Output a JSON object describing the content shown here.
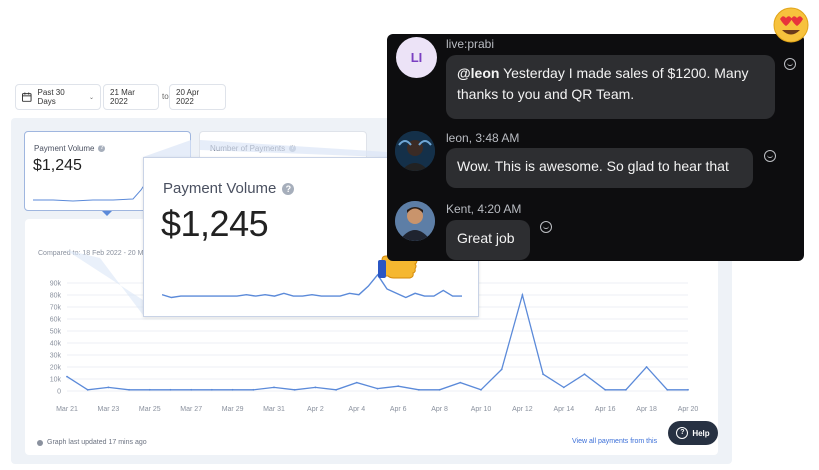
{
  "filters": {
    "range_label": "Past 30 Days",
    "start_date": "21 Mar 2022",
    "to_label": "to",
    "end_date": "20 Apr 2022"
  },
  "cards": {
    "payment_volume": {
      "title": "Payment Volume",
      "value": "$1,245"
    },
    "number_of_payments": {
      "title": "Number of Payments"
    }
  },
  "chart": {
    "compared_to": "Compared to: 18 Feb 2022 - 20 M",
    "footer_note": "Graph last updated 17 mins ago",
    "view_all": "View all payments from this"
  },
  "chart_data": {
    "type": "line",
    "x": [
      "Mar 21",
      "Mar 22",
      "Mar 23",
      "Mar 24",
      "Mar 25",
      "Mar 26",
      "Mar 27",
      "Mar 28",
      "Mar 29",
      "Mar 30",
      "Mar 31",
      "Apr 1",
      "Apr 2",
      "Apr 3",
      "Apr 4",
      "Apr 5",
      "Apr 6",
      "Apr 7",
      "Apr 8",
      "Apr 9",
      "Apr 10",
      "Apr 11",
      "Apr 12",
      "Apr 13",
      "Apr 14",
      "Apr 15",
      "Apr 16",
      "Apr 17",
      "Apr 18",
      "Apr 19",
      "Apr 20"
    ],
    "x_tick_labels": [
      "Mar 21",
      "Mar 23",
      "Mar 25",
      "Mar 27",
      "Mar 29",
      "Mar 31",
      "Apr 2",
      "Apr 4",
      "Apr 6",
      "Apr 8",
      "Apr 10",
      "Apr 12",
      "Apr 14",
      "Apr 16",
      "Apr 18",
      "Apr 20"
    ],
    "values": [
      12000,
      1000,
      3000,
      1000,
      1000,
      1000,
      1000,
      1000,
      1000,
      1000,
      3000,
      1000,
      3000,
      1000,
      7000,
      2000,
      4000,
      1000,
      1000,
      7000,
      1000,
      18000,
      80000,
      14000,
      3000,
      14000,
      1000,
      1000,
      20000,
      1000,
      1000
    ],
    "y_ticks": [
      0,
      10000,
      20000,
      30000,
      40000,
      50000,
      60000,
      70000,
      80000,
      90000
    ],
    "y_tick_labels": [
      "0",
      "10k",
      "20k",
      "30k",
      "40k",
      "50k",
      "60k",
      "70k",
      "80k",
      "90k"
    ],
    "ylim": [
      0,
      90000
    ],
    "line_color": "#5b8ad9",
    "grid": true
  },
  "zoom": {
    "title": "Payment Volume",
    "value": "$1,245",
    "sparkline": [
      8,
      6,
      7,
      7,
      7,
      7,
      7,
      7,
      7,
      8,
      7,
      8,
      7,
      9,
      7,
      7,
      8,
      7,
      7,
      7,
      9,
      8,
      14,
      22,
      12,
      9,
      6,
      9,
      7,
      7,
      11,
      7,
      7
    ]
  },
  "help": {
    "label": "Help"
  },
  "chat": {
    "messages": [
      {
        "sender": "live:prabi",
        "avatar_initials": "LI",
        "text_mention": "@leon",
        "text": " Yesterday I made sales of $1200. Many thanks to you and QR Team."
      },
      {
        "sender": "leon, 3:48 AM",
        "text": "Wow. This is awesome. So glad to hear that"
      },
      {
        "sender": "Kent, 4:20 AM",
        "text": "Great job"
      }
    ]
  },
  "colors": {
    "accent": "#5b8ad9",
    "chat_bg": "#0d0d0f",
    "bubble_bg": "#2d2e31",
    "avatar_li_bg": "#ece3f7",
    "avatar_li_text": "#7a3fc2"
  }
}
